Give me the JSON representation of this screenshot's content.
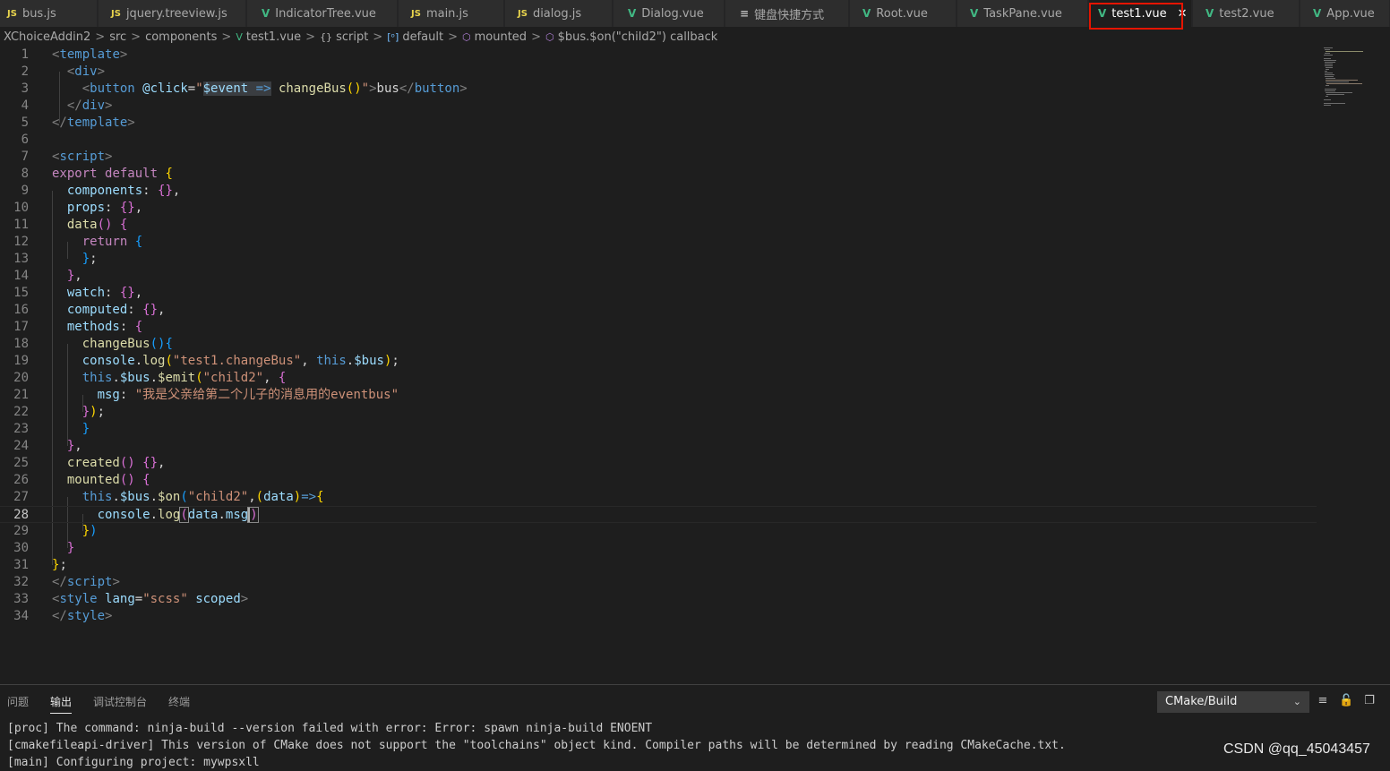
{
  "tabs": [
    {
      "icon": "js-file-icon",
      "icon_text": "JS",
      "label": "bus.js"
    },
    {
      "icon": "js-file-icon",
      "icon_text": "JS",
      "label": "jquery.treeview.js"
    },
    {
      "icon": "vue-file-icon",
      "icon_text": "V",
      "label": "IndicatorTree.vue"
    },
    {
      "icon": "js-file-icon",
      "icon_text": "JS",
      "label": "main.js"
    },
    {
      "icon": "js-file-icon",
      "icon_text": "JS",
      "label": "dialog.js"
    },
    {
      "icon": "vue-file-icon",
      "icon_text": "V",
      "label": "Dialog.vue"
    },
    {
      "icon": "text-file-icon",
      "icon_text": "≡",
      "label": "键盘快捷方式"
    },
    {
      "icon": "vue-file-icon",
      "icon_text": "V",
      "label": "Root.vue"
    },
    {
      "icon": "vue-file-icon",
      "icon_text": "V",
      "label": "TaskPane.vue"
    },
    {
      "icon": "vue-file-icon",
      "icon_text": "V",
      "label": "test1.vue",
      "active": true,
      "close": "✕"
    },
    {
      "icon": "vue-file-icon",
      "icon_text": "V",
      "label": "test2.vue"
    },
    {
      "icon": "vue-file-icon",
      "icon_text": "V",
      "label": "App.vue"
    }
  ],
  "breadcrumb": {
    "items": [
      "XChoiceAddin2",
      "src",
      "components",
      "test1.vue",
      "script",
      "default",
      "mounted",
      "$bus.$on(\"child2\") callback"
    ],
    "separator": ">",
    "file_icon": "V",
    "script_icon": "{}",
    "default_icon": "[ᵒ]",
    "mounted_icon": "⬡",
    "callback_icon": "⬡"
  },
  "editor": {
    "current_line": 28,
    "line_numbers": [
      "1",
      "2",
      "3",
      "4",
      "5",
      "6",
      "7",
      "8",
      "9",
      "10",
      "11",
      "12",
      "13",
      "14",
      "15",
      "16",
      "17",
      "18",
      "19",
      "20",
      "21",
      "22",
      "23",
      "24",
      "25",
      "26",
      "27",
      "28",
      "29",
      "30",
      "31",
      "32",
      "33",
      "34"
    ]
  },
  "panel": {
    "tabs": [
      "问题",
      "输出",
      "调试控制台",
      "终端"
    ],
    "active_tab": "输出",
    "channel": "CMake/Build",
    "output_lines": [
      "[proc] The command: ninja-build --version failed with error: Error: spawn ninja-build ENOENT",
      "[cmakefileapi-driver] This version of CMake does not support the \"toolchains\" object kind. Compiler paths will be determined by reading CMakeCache.txt.",
      "[main] Configuring project: mywpsxll"
    ]
  },
  "watermark": "CSDN @qq_45043457",
  "colors": {
    "accent_red": "#e51400",
    "vue_green": "#41b883",
    "js_yellow": "#e8d44d"
  }
}
